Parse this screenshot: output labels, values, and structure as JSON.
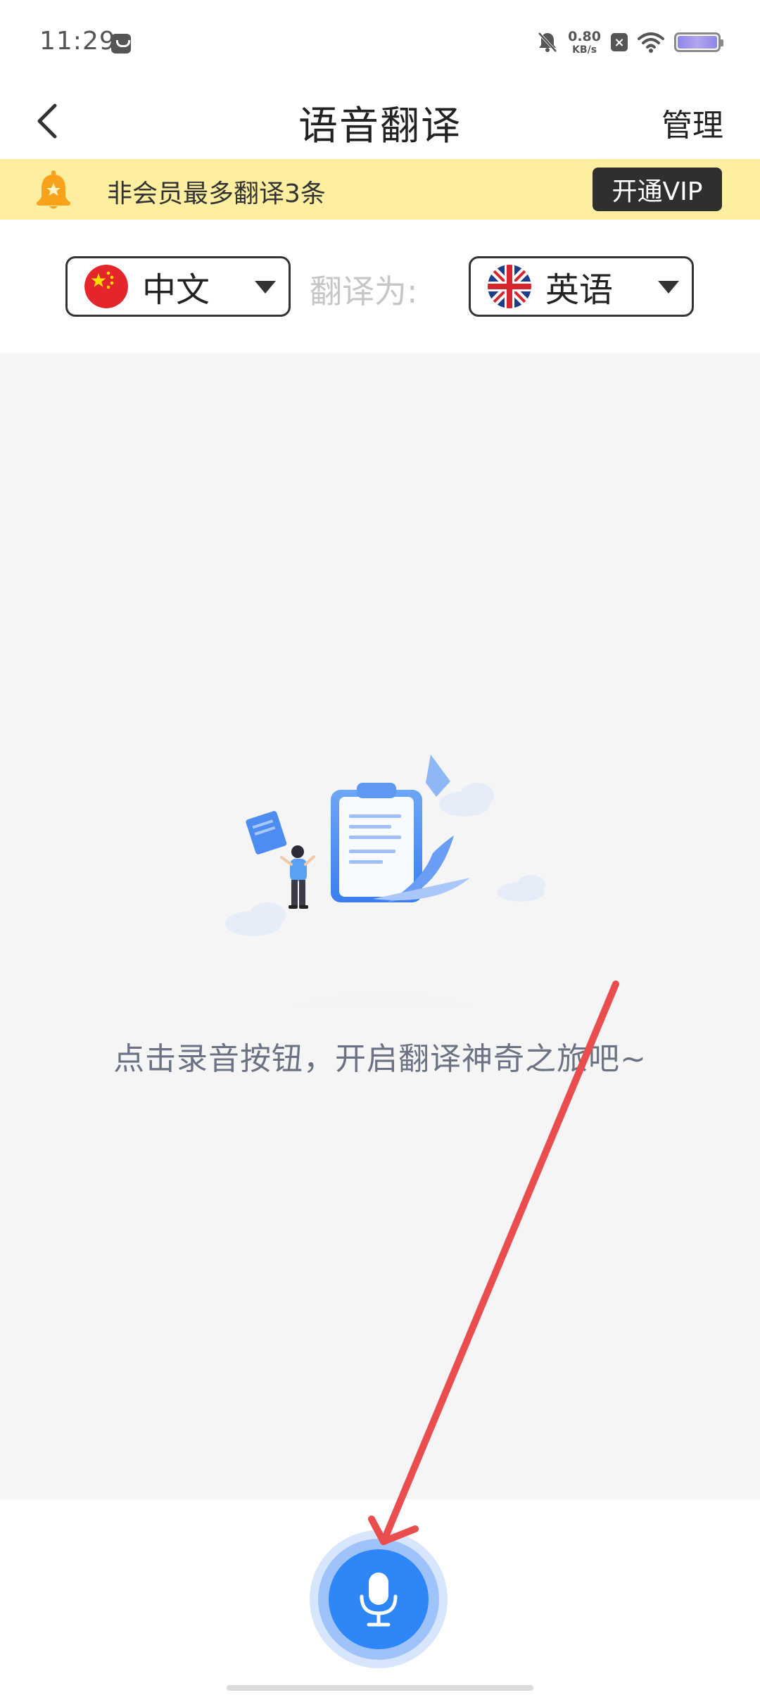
{
  "status_bar": {
    "time": "11:29",
    "net_speed_value": "0.80",
    "net_speed_unit": "KB/s",
    "icons": [
      "message-icon",
      "bell-off-icon",
      "close-box-icon",
      "wifi-icon",
      "battery-icon"
    ]
  },
  "header": {
    "title": "语音翻译",
    "manage_label": "管理"
  },
  "vip_banner": {
    "text": "非会员最多翻译3条",
    "button_label": "开通VIP",
    "background_color": "#fdeea0"
  },
  "language": {
    "source": "中文",
    "target": "英语",
    "translate_to_label": "翻译为:"
  },
  "main": {
    "hint": "点击录音按钮，开启翻译神奇之旅吧~"
  },
  "colors": {
    "accent": "#2f86f6",
    "annotation_arrow": "#ea4d4d"
  }
}
